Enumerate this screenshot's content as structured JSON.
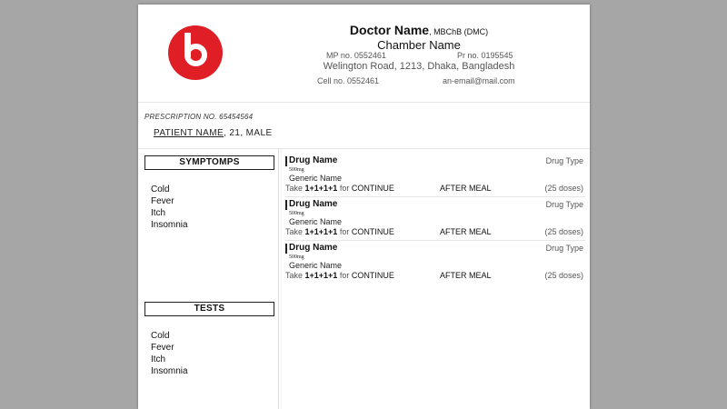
{
  "brand": {
    "logo_color": "#e01e26"
  },
  "doctor": {
    "name": "Doctor Name",
    "degree": ", MBChB (DMC)",
    "chamber": "Chamber Name",
    "mp_no": "MP no. 0552461",
    "pr_no": "Pr no. 0195545",
    "address": "Welington Road, 1213, Dhaka, Bangladesh",
    "cell_no": "Cell no. 0552461",
    "email": "an-email@mail.com"
  },
  "prescription": {
    "number_label": "PRESCRIPTION NO. 65454564"
  },
  "patient": {
    "name_label": "PATIENT NAME",
    "details": ", 21, MALE"
  },
  "symptoms": {
    "title": "SYMPTOMPS",
    "items": [
      "Cold",
      "Fever",
      "Itch",
      "Insomnia"
    ]
  },
  "tests": {
    "title": "TESTS",
    "items": [
      "Cold",
      "Fever",
      "Itch",
      "Insomnia"
    ]
  },
  "drugs": [
    {
      "name": "Drug Name",
      "type": "Drug Type",
      "strength": "500mg",
      "generic": "Generic Name",
      "take_prefix": "Take ",
      "dose": "1+1+1+1",
      "for_text": " for ",
      "duration": "CONTINUE",
      "meal": "AFTER MEAL",
      "doses": "(25 doses)"
    },
    {
      "name": "Drug Name",
      "type": "Drug Type",
      "strength": "500mg",
      "generic": "Generic Name",
      "take_prefix": "Take ",
      "dose": "1+1+1+1",
      "for_text": " for ",
      "duration": "CONTINUE",
      "meal": "AFTER MEAL",
      "doses": "(25 doses)"
    },
    {
      "name": "Drug Name",
      "type": "Drug Type",
      "strength": "500mg",
      "generic": "Generic Name",
      "take_prefix": "Take ",
      "dose": "1+1+1+1",
      "for_text": " for ",
      "duration": "CONTINUE",
      "meal": "AFTER MEAL",
      "doses": "(25 doses)"
    }
  ]
}
